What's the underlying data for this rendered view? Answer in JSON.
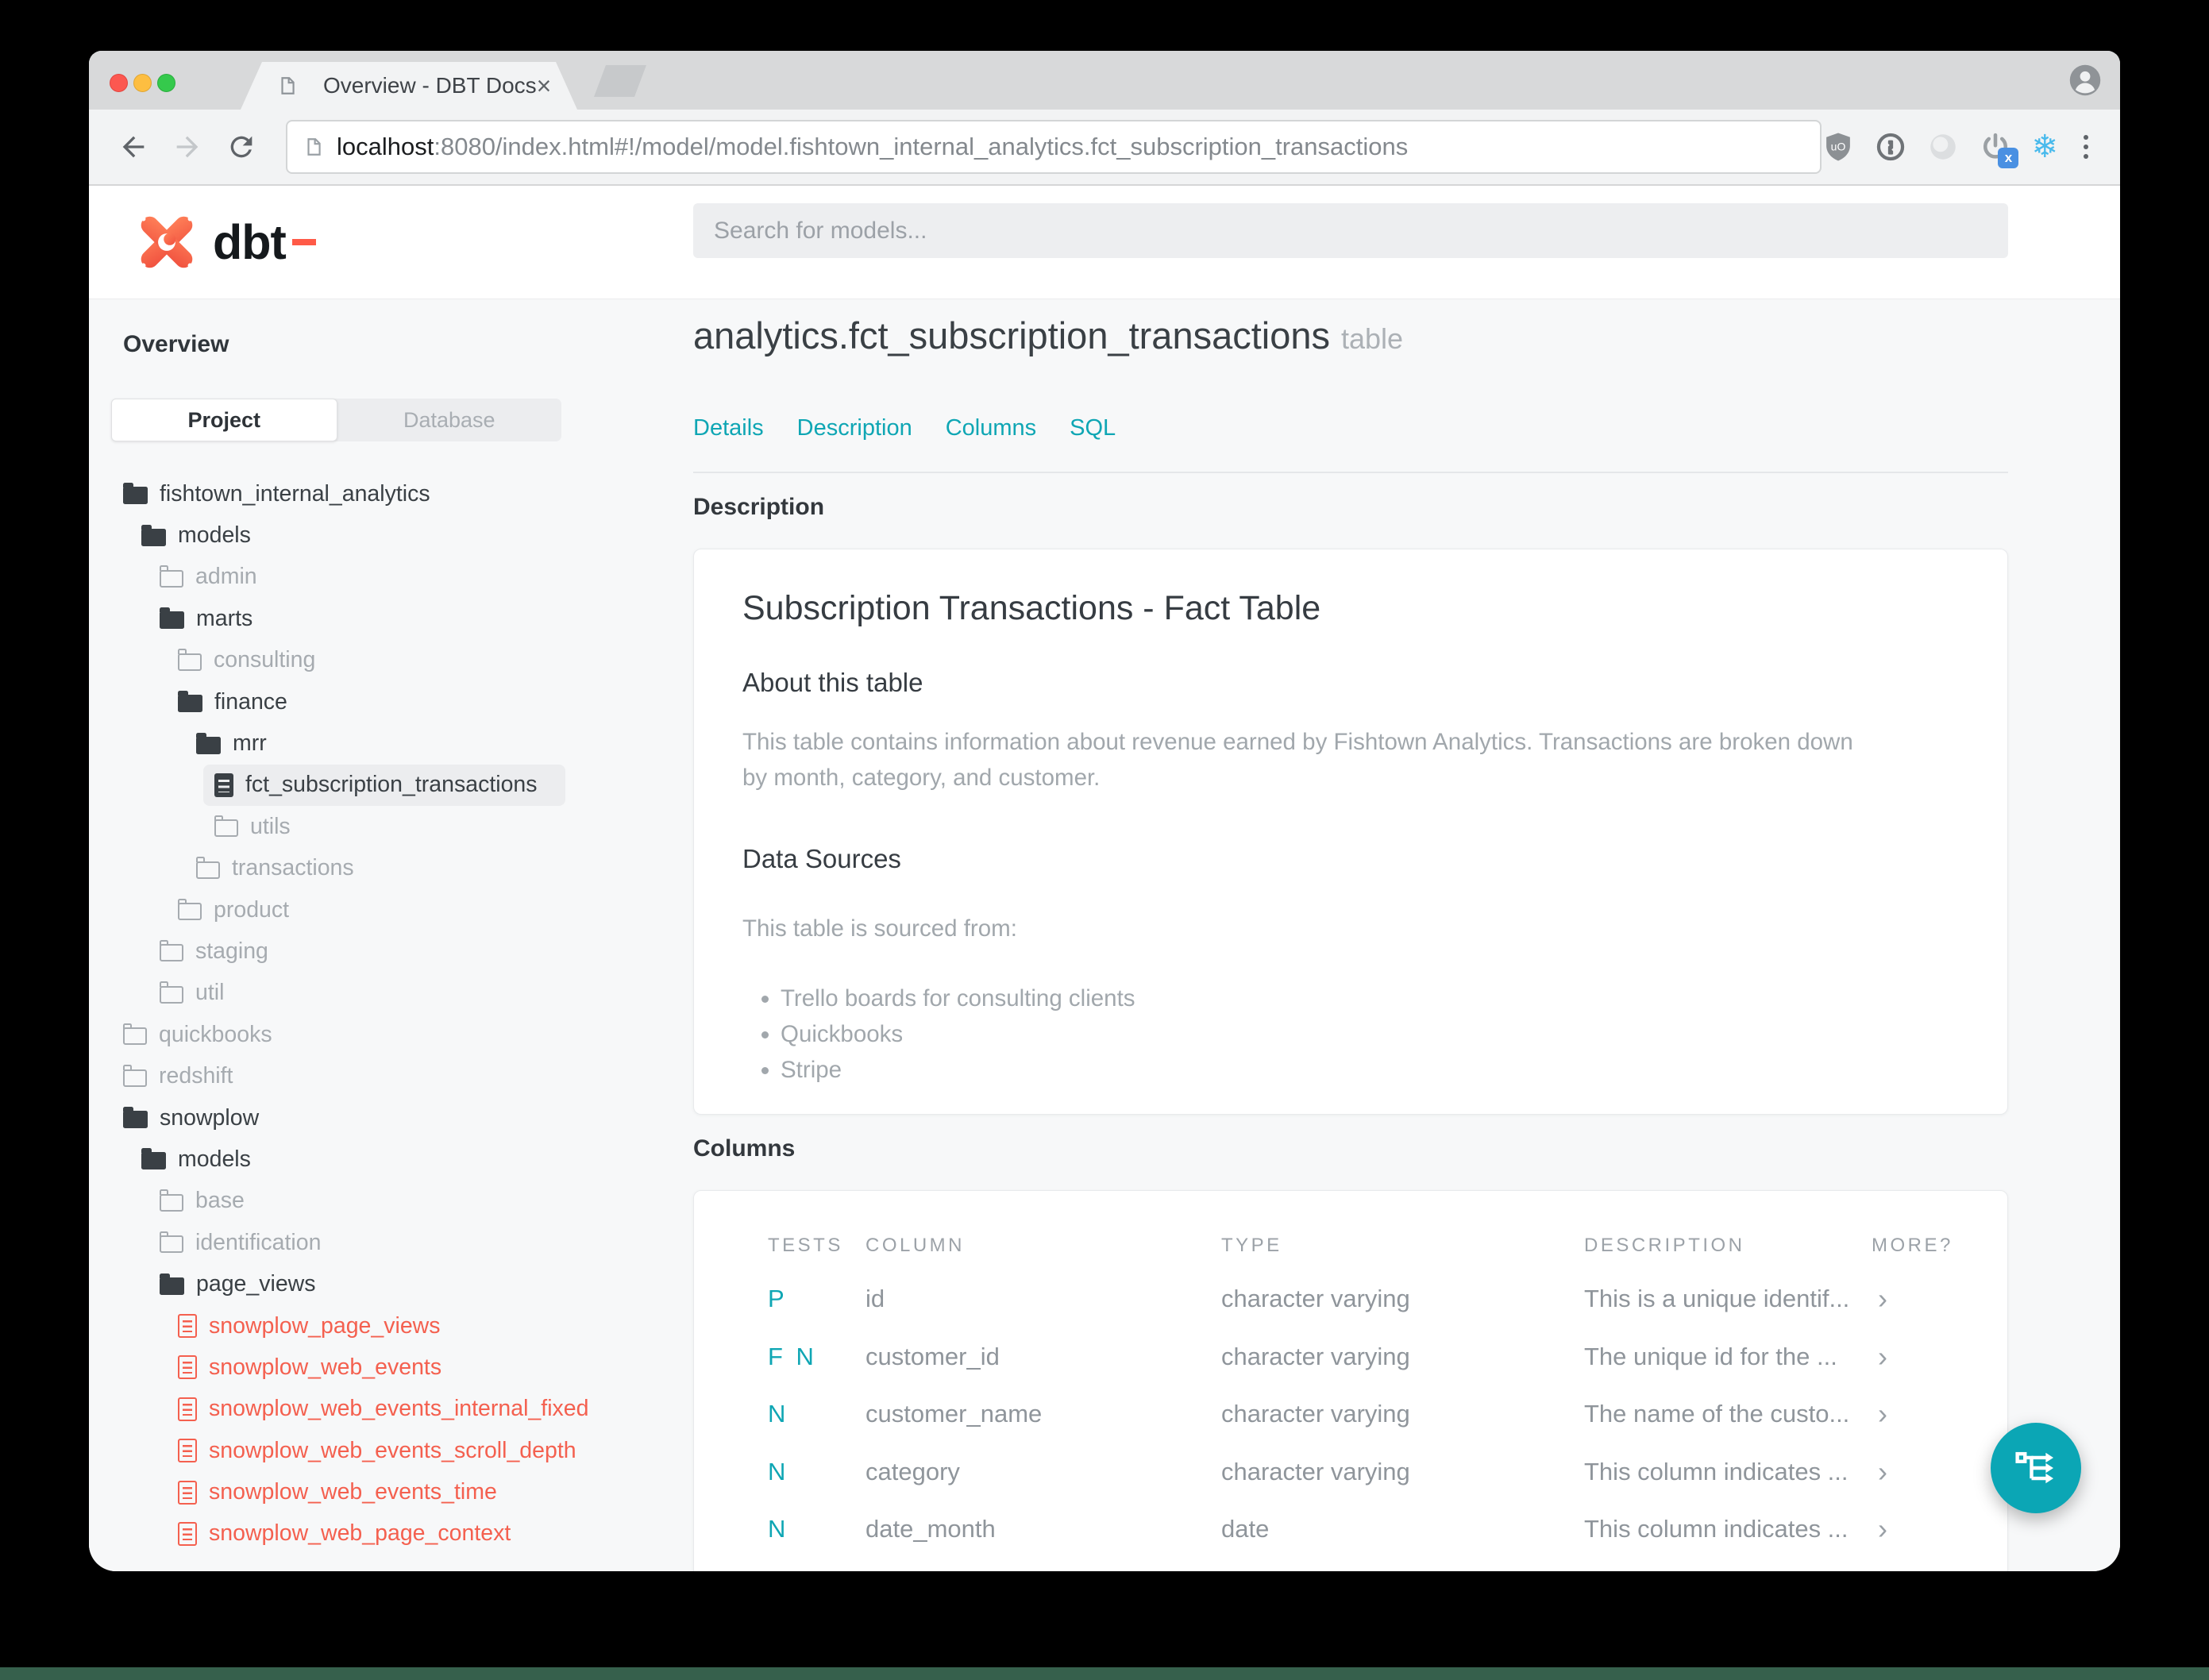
{
  "browser": {
    "tab_title": "Overview - DBT Docs",
    "tab_close": "×",
    "url_host": "localhost",
    "url_rest": ":8080/index.html#!/model/model.fishtown_internal_analytics.fct_subscription_transactions"
  },
  "header": {
    "logo_text": "dbt",
    "search_placeholder": "Search for models..."
  },
  "sidebar": {
    "title": "Overview",
    "tabs": [
      {
        "label": "Project",
        "active": true
      },
      {
        "label": "Database",
        "active": false
      }
    ],
    "tree": [
      {
        "label": "fishtown_internal_analytics",
        "icon": "folder-open",
        "state": "expanded"
      },
      {
        "label": "models",
        "icon": "folder-open",
        "state": "expanded"
      },
      {
        "label": "admin",
        "icon": "folder-closed",
        "state": "collapsed"
      },
      {
        "label": "marts",
        "icon": "folder-open",
        "state": "expanded"
      },
      {
        "label": "consulting",
        "icon": "folder-closed",
        "state": "collapsed"
      },
      {
        "label": "finance",
        "icon": "folder-open",
        "state": "expanded"
      },
      {
        "label": "mrr",
        "icon": "folder-open",
        "state": "expanded"
      },
      {
        "label": "fct_subscription_transactions",
        "icon": "file",
        "state": "selected"
      },
      {
        "label": "utils",
        "icon": "folder-closed",
        "state": "collapsed"
      },
      {
        "label": "transactions",
        "icon": "folder-closed",
        "state": "collapsed"
      },
      {
        "label": "product",
        "icon": "folder-closed",
        "state": "collapsed"
      },
      {
        "label": "staging",
        "icon": "folder-closed",
        "state": "collapsed"
      },
      {
        "label": "util",
        "icon": "folder-closed",
        "state": "collapsed"
      },
      {
        "label": "quickbooks",
        "icon": "folder-closed",
        "state": "collapsed"
      },
      {
        "label": "redshift",
        "icon": "folder-closed",
        "state": "collapsed"
      },
      {
        "label": "snowplow",
        "icon": "folder-open",
        "state": "expanded"
      },
      {
        "label": "models",
        "icon": "folder-open",
        "state": "expanded"
      },
      {
        "label": "base",
        "icon": "folder-closed",
        "state": "collapsed"
      },
      {
        "label": "identification",
        "icon": "folder-closed",
        "state": "collapsed"
      },
      {
        "label": "page_views",
        "icon": "folder-open",
        "state": "expanded"
      },
      {
        "label": "snowplow_page_views",
        "icon": "file-red",
        "state": "model"
      },
      {
        "label": "snowplow_web_events",
        "icon": "file-red",
        "state": "model"
      },
      {
        "label": "snowplow_web_events_internal_fixed",
        "icon": "file-red",
        "state": "model"
      },
      {
        "label": "snowplow_web_events_scroll_depth",
        "icon": "file-red",
        "state": "model"
      },
      {
        "label": "snowplow_web_events_time",
        "icon": "file-red",
        "state": "model"
      },
      {
        "label": "snowplow_web_page_context",
        "icon": "file-red",
        "state": "model"
      }
    ]
  },
  "main": {
    "title": "analytics.fct_subscription_transactions",
    "title_suffix": "table",
    "nav": [
      "Details",
      "Description",
      "Columns",
      "SQL"
    ],
    "description_section": {
      "heading": "Description",
      "card": {
        "title": "Subscription Transactions - Fact Table",
        "about_heading": "About this table",
        "about_text": "This table contains information about revenue earned by Fishtown Analytics. Transactions are broken down by month, category, and customer.",
        "sources_heading": "Data Sources",
        "sources_intro": "This table is sourced from:",
        "sources": [
          "Trello boards for consulting clients",
          "Quickbooks",
          "Stripe"
        ]
      }
    },
    "columns_section": {
      "heading": "Columns",
      "table": {
        "headers": [
          "TESTS",
          "COLUMN",
          "TYPE",
          "DESCRIPTION",
          "MORE?"
        ],
        "rows": [
          {
            "tests": "P",
            "column": "id",
            "type": "character varying",
            "description": "This is a unique identif...",
            "more": "›"
          },
          {
            "tests": "F N",
            "column": "customer_id",
            "type": "character varying",
            "description": "The unique id for the ...",
            "more": "›"
          },
          {
            "tests": "N",
            "column": "customer_name",
            "type": "character varying",
            "description": "The name of the custo...",
            "more": "›"
          },
          {
            "tests": "N",
            "column": "category",
            "type": "character varying",
            "description": "This column indicates ...",
            "more": "›"
          },
          {
            "tests": "N",
            "column": "date_month",
            "type": "date",
            "description": "This column indicates ...",
            "more": "›"
          }
        ]
      }
    }
  },
  "colors": {
    "accent_teal": "#0FA6B4",
    "model_red": "#F4604F",
    "logo_orange": "#FF5A47"
  }
}
